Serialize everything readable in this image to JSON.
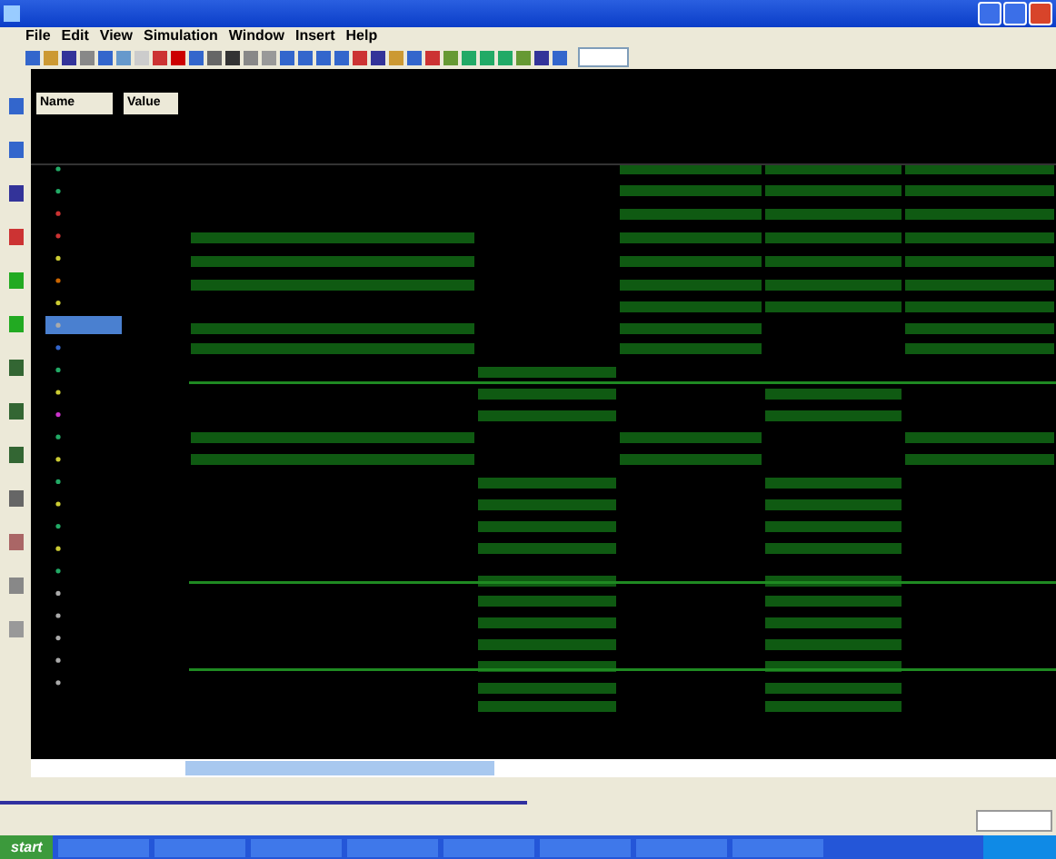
{
  "menu": [
    "File",
    "Edit",
    "View",
    "Simulation",
    "Window",
    "Insert",
    "Help"
  ],
  "columns": [
    "Name",
    "Value"
  ],
  "taskbar": {
    "start": "start"
  }
}
